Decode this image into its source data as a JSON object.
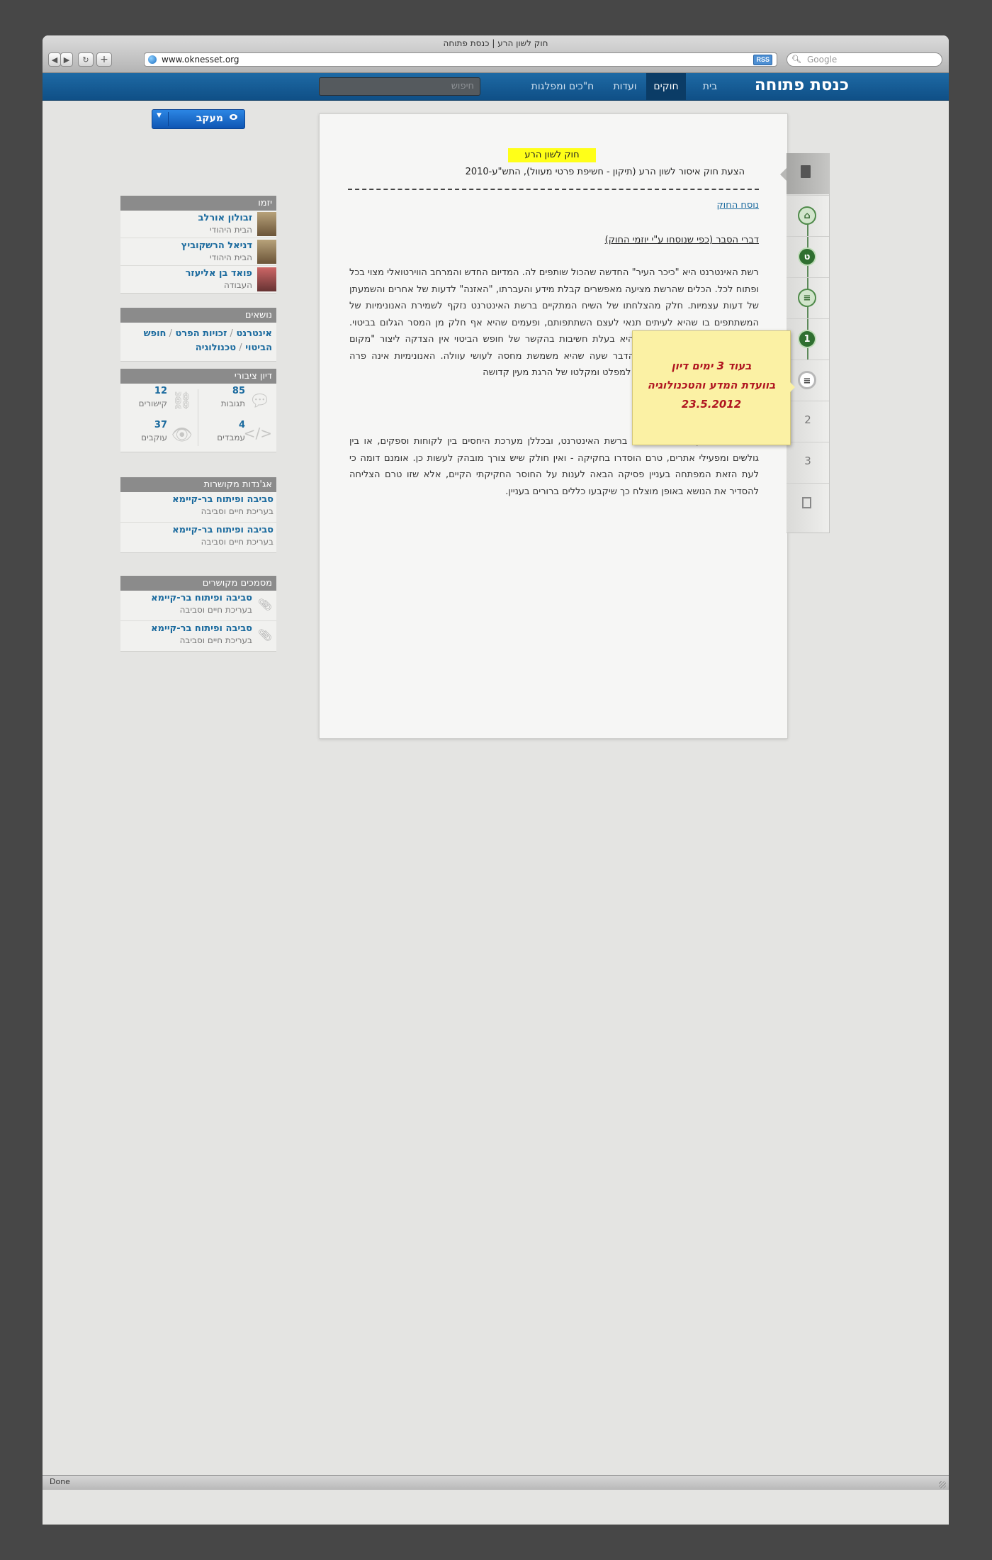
{
  "browser": {
    "window_title": "חוק לשון הרע | כנסת פתוחה",
    "url": "www.oknesset.org",
    "rss_label": "RSS",
    "search_placeholder": "Google",
    "status": "Done"
  },
  "site": {
    "logo": "כנסת פתוחה",
    "nav": [
      "בית",
      "חוקים",
      "ועדות",
      "ח\"כים ומפלגות"
    ],
    "active_nav": "חוקים",
    "search_placeholder": "חיפוש"
  },
  "follow_button": {
    "label": "מעקב"
  },
  "initiators": {
    "title": "יזמו",
    "people": [
      {
        "name": "זבולון אורלב",
        "party": "הבית היהודי"
      },
      {
        "name": "דניאל הרשקוביץ",
        "party": "הבית היהודי"
      },
      {
        "name": "פואד בן אליעזר",
        "party": "העבודה"
      }
    ]
  },
  "topics": {
    "title": "נושאים",
    "items": [
      "אינטרנט",
      "זכויות הפרט",
      "חופש הביטוי",
      "טכנולוגיה"
    ]
  },
  "public_discussion": {
    "title": "דיון ציבורי",
    "stats": [
      {
        "value": "85",
        "label": "תגובות",
        "icon": "comments-icon"
      },
      {
        "value": "12",
        "label": "קישורים",
        "icon": "link-icon"
      },
      {
        "value": "4",
        "label": "עמבדים",
        "icon": "embed-icon"
      },
      {
        "value": "37",
        "label": "עוקבים",
        "icon": "eye-icon"
      }
    ]
  },
  "related_agendas": {
    "title": "אג'נדות מקושרות",
    "items": [
      {
        "title": "סביבה ופיתוח בר-קיימא",
        "subtitle": "בעריכת חיים וסביבה"
      },
      {
        "title": "סביבה ופיתוח בר-קיימא",
        "subtitle": "בעריכת חיים וסביבה"
      }
    ]
  },
  "related_docs": {
    "title": "מסמכים מקושרים",
    "items": [
      {
        "title": "סביבה ופיתוח בר-קיימא",
        "subtitle": "בעריכת חיים וסביבה"
      },
      {
        "title": "סביבה ופיתוח בר-קיימא",
        "subtitle": "בעריכת חיים וסביבה"
      }
    ]
  },
  "document": {
    "law_title": "חוק לשון הרע",
    "proposal": "הצעת חוק איסור לשון הרע (תיקון - חשיפת פרטי מעוול), התש\"ע-2010",
    "version_link": "נוסח החוק",
    "explanation_heading": "דברי הסבר (כפי שנוסחו ע\"י יוזמי החוק)",
    "para1": "רשת האינטרנט היא \"כיכר העיר\" החדשה שהכול שותפים לה. המדיום החדש והמרחב הווירטואלי מצוי בכל ופתוח לכל. הכלים שהרשת מציעה מאפשרים קבלת מידע והעברתו, \"האזנה\" לדעות של אחרים והשמעתן של דעות עצמיות. חלק מהצלחתו של השיח המתקיים ברשת האינטרנט נזקף לשמירת האנונימיות של המשתתפים בו שהיא לעיתים תנאי לעצם השתתפותם, ופעמים שהיא אף חלק מן המסר הגלום בביטוי. אולם, אף על פי שהאנונימיות היא בעלת חשיבות בהקשר של חופש הביטוי אין הצדקה ליצור \"מקום מפלט\" למעוולים, והוא בודאי הדבר שעה שהיא משמשת מחסה לעושי עוולה. האנונימיות אינה פרה קדושה, אינה יכולה להפוך אותה למפלט ומקלטו של הרגת מעין קדושה",
    "para2": "סוגיה זו היא מן הבוערות ביותר ברשת האינטרנט, ובכללן מערכת היחסים בין לקוחות וספקים, או בין גולשים ומפעילי אתרים, טרם הוסדרו בחקיקה - ואין חולק שיש צורך מובהק לעשות כן. אומנם דומה כי לעת הזאת המפתחה בעניין פסיקה הבאה לענות על החוסר החקיקתי הקיים, אלא שזו טרם הצליחה להסדיר את הנושא באופן מוצלח כך שיקבעו כללים ברורים בעניין."
  },
  "timeline": {
    "stages": [
      "1",
      "2",
      "3"
    ],
    "node_letters": [
      "ט",
      "1"
    ]
  },
  "sticky_note": {
    "line1": "בעוד 3 ימים דיון",
    "line2": "בוועדת המדע והטכנולוגיה",
    "line3": "23.5.2012"
  }
}
